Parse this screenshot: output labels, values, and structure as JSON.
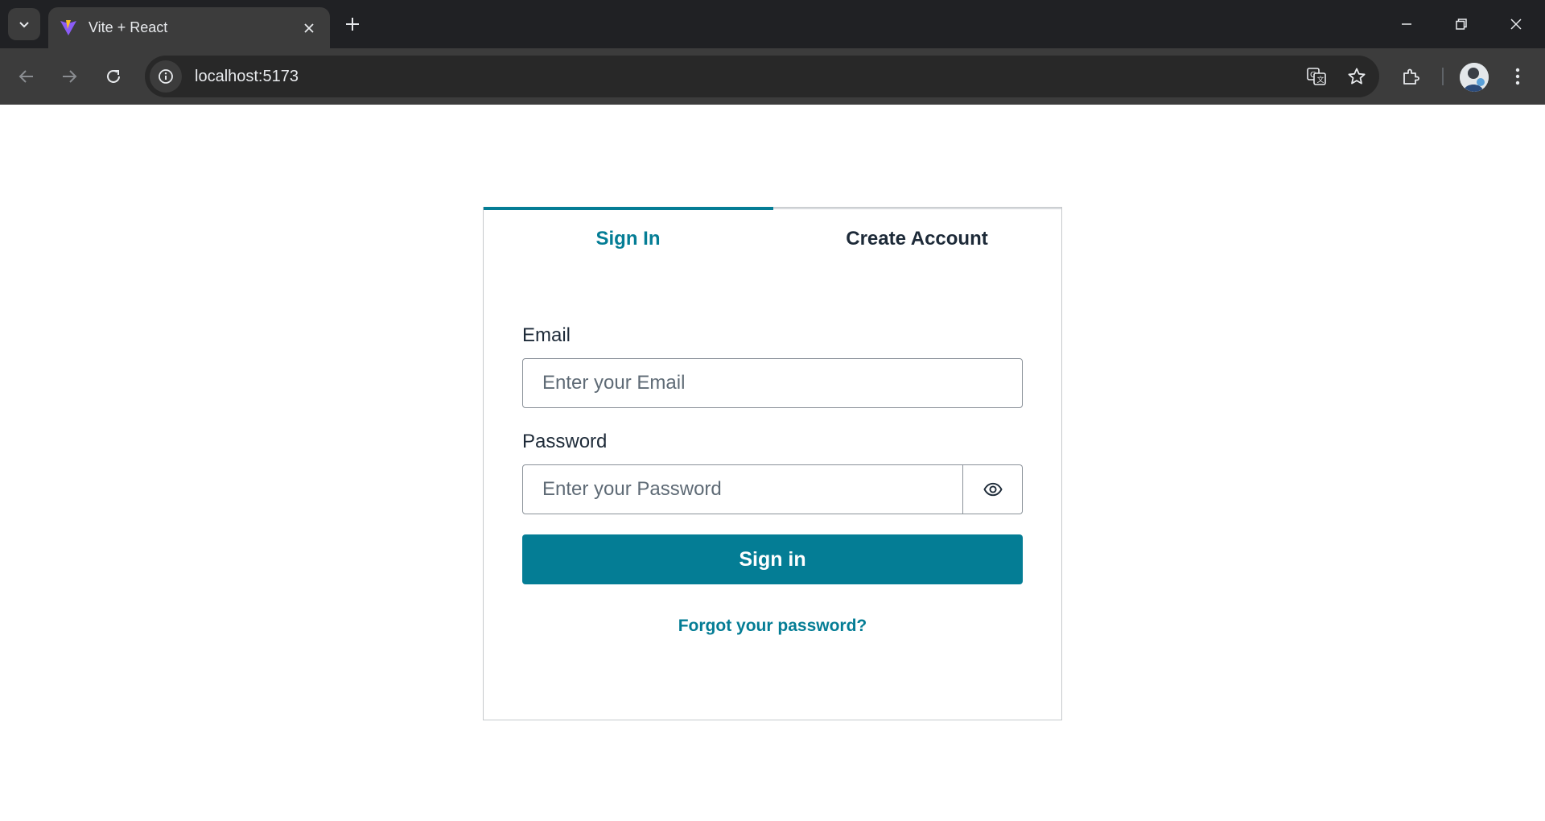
{
  "browser": {
    "tab_title": "Vite + React",
    "url": "localhost:5173"
  },
  "auth": {
    "tabs": [
      {
        "label": "Sign In",
        "active": true
      },
      {
        "label": "Create Account",
        "active": false
      }
    ],
    "email_label": "Email",
    "email_placeholder": "Enter your Email",
    "password_label": "Password",
    "password_placeholder": "Enter your Password",
    "signin_button": "Sign in",
    "forgot_link": "Forgot your password?"
  },
  "colors": {
    "accent": "#047d95",
    "chrome_dark": "#202124",
    "chrome_toolbar": "#3c3c3c"
  },
  "icons": [
    "tab-search-icon",
    "vite-favicon-icon",
    "close-icon",
    "plus-icon",
    "minimize-icon",
    "restore-icon",
    "window-close-icon",
    "back-icon",
    "forward-icon",
    "reload-icon",
    "site-info-icon",
    "translate-icon",
    "star-icon",
    "extensions-icon",
    "profile-avatar",
    "more-menu-icon",
    "eye-icon"
  ]
}
